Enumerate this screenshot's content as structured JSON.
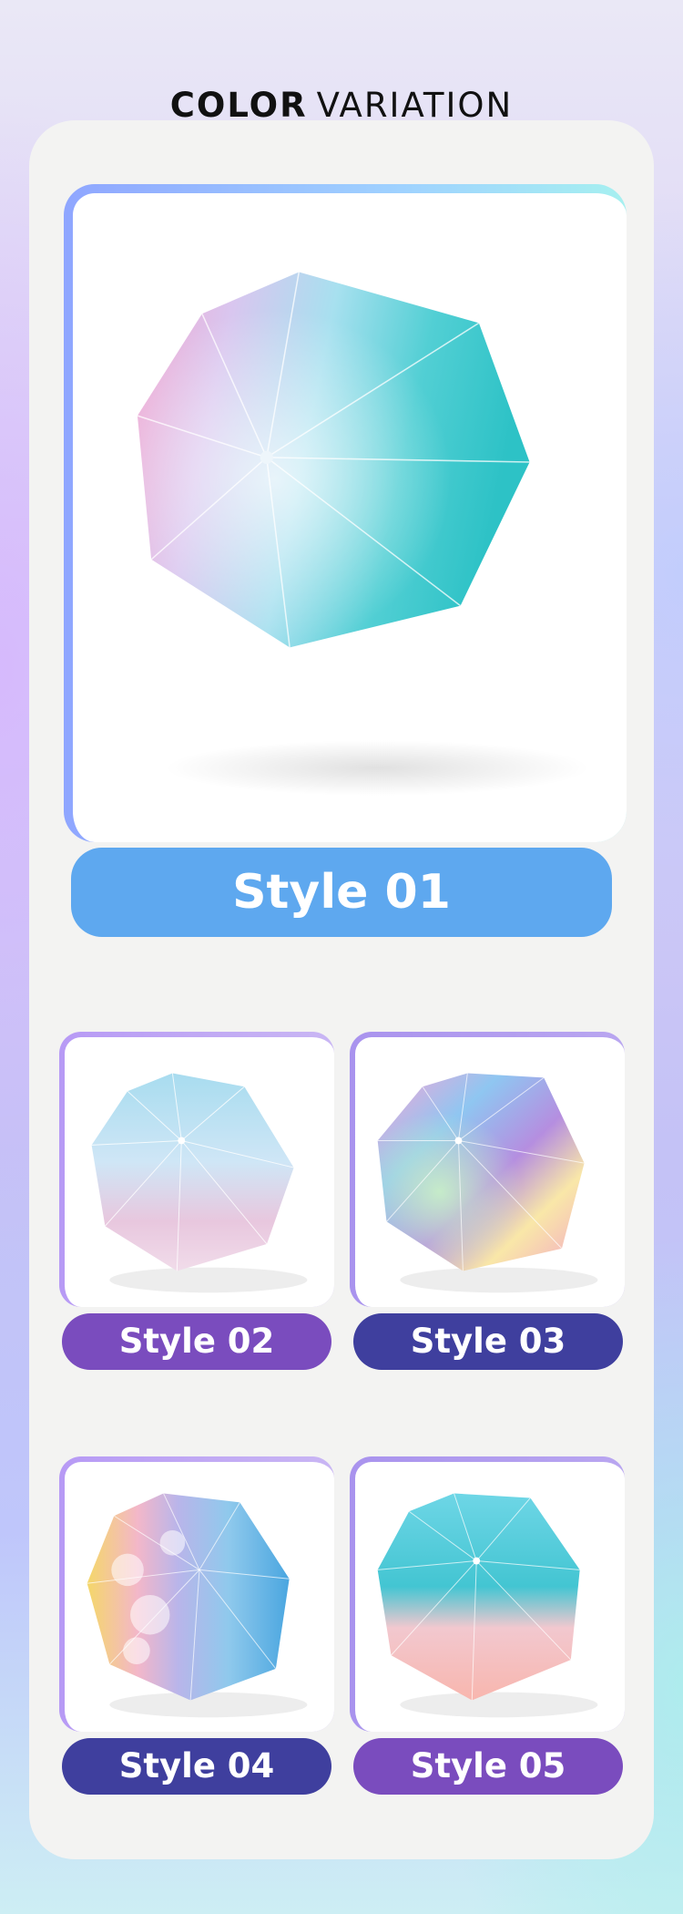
{
  "header": {
    "title_bold": "COLOR",
    "title_light": "VARIATION"
  },
  "products": [
    {
      "label": "Style 01",
      "label_color": "#5ea8ef",
      "icon": "umbrella-image"
    },
    {
      "label": "Style 02",
      "label_color": "#7a4cbe",
      "icon": "umbrella-image"
    },
    {
      "label": "Style 03",
      "label_color": "#3f3f9e",
      "icon": "umbrella-image"
    },
    {
      "label": "Style 04",
      "label_color": "#3f3f9e",
      "icon": "umbrella-image"
    },
    {
      "label": "Style 05",
      "label_color": "#7a4cbe",
      "icon": "umbrella-image"
    }
  ]
}
